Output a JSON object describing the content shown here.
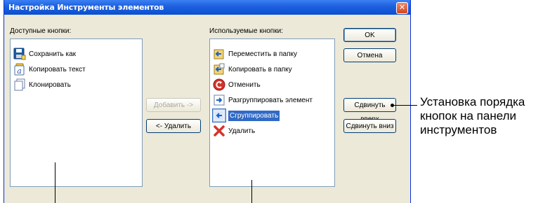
{
  "window": {
    "title": "Настройка Инструменты элементов",
    "close_glyph": "✕"
  },
  "available": {
    "label": "Доступные кнопки:",
    "items": [
      {
        "label": "Сохранить как",
        "icon": "save-as-icon"
      },
      {
        "label": "Копировать текст",
        "icon": "copy-text-icon"
      },
      {
        "label": "Клонировать",
        "icon": "clone-icon"
      }
    ]
  },
  "used": {
    "label": "Используемые кнопки:",
    "items": [
      {
        "label": "Переместить в папку",
        "icon": "move-to-folder-icon"
      },
      {
        "label": "Копировать в папку",
        "icon": "copy-to-folder-icon"
      },
      {
        "label": "Отменить",
        "icon": "undo-icon"
      },
      {
        "label": "Разгруппировать элемент",
        "icon": "ungroup-icon"
      },
      {
        "label": "Сгруппировать",
        "icon": "group-icon",
        "selected": true
      },
      {
        "label": "Удалить",
        "icon": "delete-icon"
      }
    ]
  },
  "buttons": {
    "add": "Добавить ->",
    "remove": "<- Удалить",
    "ok": "OK",
    "cancel": "Отмена",
    "move_up": "Сдвинуть вверх",
    "move_down": "Сдвинуть вниз"
  },
  "callout": {
    "text": "Установка порядка кнопок на панели инструментов"
  },
  "colors": {
    "titlebar": "#0a4fd0",
    "dialog_bg": "#ece9d8",
    "selection": "#316ac5"
  }
}
